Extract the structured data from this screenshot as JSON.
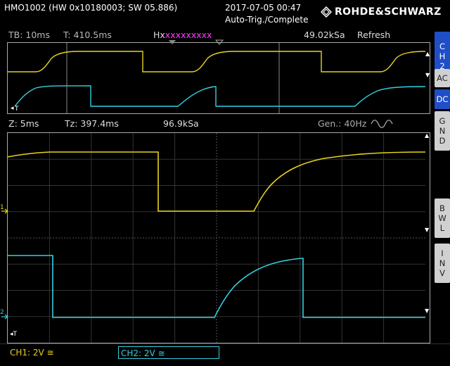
{
  "header": {
    "device_id": "HMO1002 (HW 0x10180003; SW 05.886)",
    "date": "2017-07-05 00:47",
    "trigger_status": "Auto-Trig./Complete",
    "brand": "ROHDE&SCHWARZ"
  },
  "overview": {
    "timebase": "TB: 10ms",
    "trigger_time": "T: 410.5ms",
    "hx_label": "Hx",
    "hx_marks": "xxxxxxxxx",
    "sample_rate": "49.02kSa",
    "mode": "Refresh",
    "t_marker": "T"
  },
  "zoom": {
    "zoom_timebase": "Z: 5ms",
    "zoom_time": "Tz: 397.4ms",
    "sample_rate": "96.9kSa",
    "generator": "Gen.: 40Hz",
    "ch1_marker": "1",
    "ch2_marker": "2",
    "t_marker": "T"
  },
  "side_panel": {
    "channel_tab": [
      "C",
      "H",
      "2"
    ],
    "buttons": [
      {
        "lines": [
          "AC"
        ],
        "active": false
      },
      {
        "lines": [
          "DC"
        ],
        "active": true
      },
      {
        "lines": [
          "G",
          "N",
          "D"
        ],
        "active": false
      },
      {
        "lines": [
          "B",
          "W",
          "L"
        ],
        "active": false
      },
      {
        "lines": [
          "I",
          "N",
          "V"
        ],
        "active": false
      }
    ]
  },
  "channels": {
    "ch1": "CH1: 2V ≅",
    "ch2": "CH2: 2V ≅"
  },
  "colors": {
    "ch1": "#e6d21e",
    "ch2": "#35d0e0",
    "accent": "#1f4ec7",
    "hx": "#ff3aff"
  }
}
